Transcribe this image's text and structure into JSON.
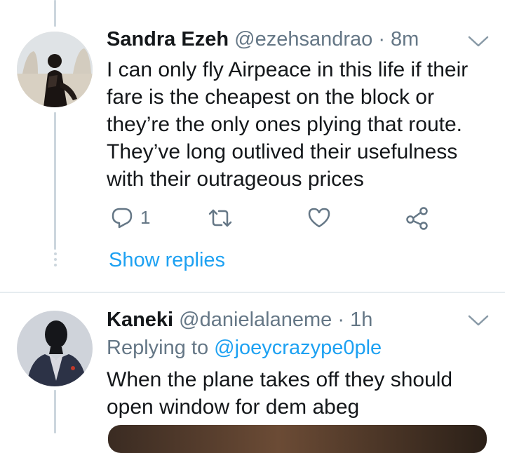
{
  "tweets": [
    {
      "name": "Sandra Ezeh",
      "handle": "@ezehsandrao",
      "time_sep": "·",
      "time": "8m",
      "text": "I can only fly Airpeace in this life if their fare is the cheapest on the block or they’re the only ones plying that route. They’ve long outlived their usefulness with their outrageous prices",
      "reply_count": "1",
      "show_replies": "Show replies"
    },
    {
      "name": "Kaneki",
      "handle": "@danielalaneme",
      "time_sep": "·",
      "time": "1h",
      "replying_prefix": "Replying to",
      "replying_to": "@joeycrazype0ple",
      "text": "When the plane takes off they should open window for dem abeg"
    }
  ],
  "colors": {
    "accent": "#1da1f2",
    "secondary_text": "#657786",
    "thread_line": "#ccd6dd",
    "icon_gray": "#657786"
  },
  "icons": [
    "reply-icon",
    "retweet-icon",
    "like-icon",
    "share-icon",
    "chevron-down-icon"
  ]
}
